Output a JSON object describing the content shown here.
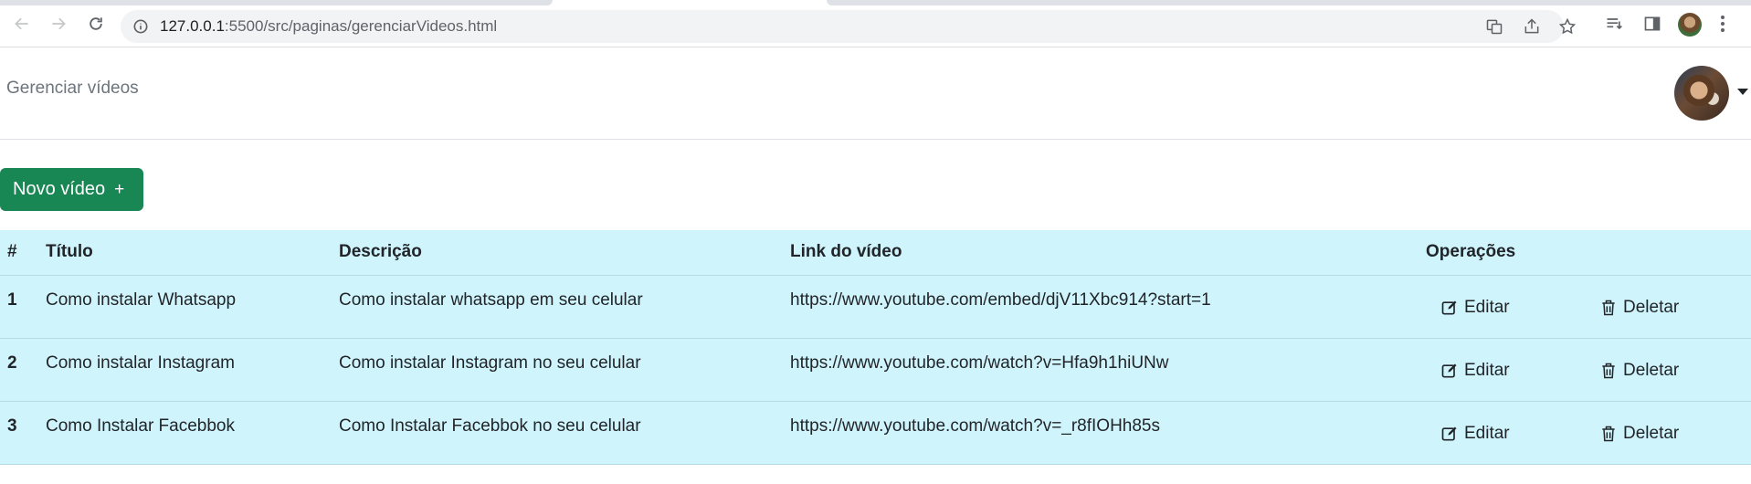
{
  "browser": {
    "url_host": "127.0.0.1",
    "url_rest": ":5500/src/paginas/gerenciarVideos.html"
  },
  "header": {
    "title": "Gerenciar vídeos"
  },
  "actions": {
    "new_video_label": "Novo vídeo",
    "new_video_icon": "+"
  },
  "table": {
    "headers": [
      "#",
      "Título",
      "Descrição",
      "Link do vídeo",
      "Operações"
    ],
    "rows": [
      {
        "id": "1",
        "title": "Como instalar Whatsapp",
        "description": "Como instalar whatsapp em seu celular",
        "link": "https://www.youtube.com/embed/djV11Xbc914?start=1",
        "edit_label": "Editar",
        "delete_label": "Deletar"
      },
      {
        "id": "2",
        "title": "Como instalar Instagram",
        "description": "Como instalar Instagram no seu celular",
        "link": "https://www.youtube.com/watch?v=Hfa9h1hiUNw",
        "edit_label": "Editar",
        "delete_label": "Deletar"
      },
      {
        "id": "3",
        "title": "Como Instalar Facebbok",
        "description": "Como Instalar Facebbok no seu celular",
        "link": "https://www.youtube.com/watch?v=_r8fIOHh85s",
        "edit_label": "Editar",
        "delete_label": "Deletar"
      }
    ]
  },
  "colors": {
    "success": "#198754",
    "table_info_bg": "#cff4fc",
    "muted_text": "#6c757d"
  }
}
